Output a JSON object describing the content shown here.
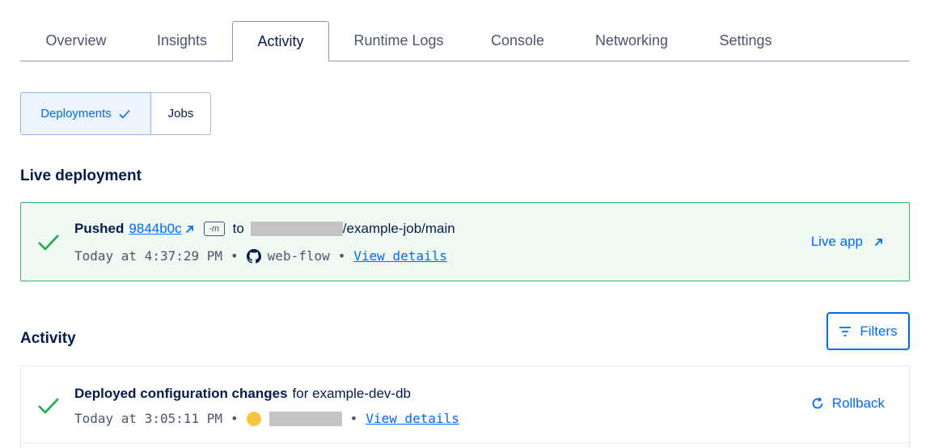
{
  "tabs": [
    {
      "label": "Overview"
    },
    {
      "label": "Insights"
    },
    {
      "label": "Activity"
    },
    {
      "label": "Runtime Logs"
    },
    {
      "label": "Console"
    },
    {
      "label": "Networking"
    },
    {
      "label": "Settings"
    }
  ],
  "active_tab": "Activity",
  "segmented": {
    "deployments_label": "Deployments",
    "jobs_label": "Jobs"
  },
  "live_deployment": {
    "section_title": "Live deployment",
    "action_word": "Pushed",
    "commit": "9844b0c",
    "flag": "-m",
    "to_word": "to",
    "repo_suffix": "/example-job/main",
    "timestamp": "Today at 4:37:29 PM",
    "separator": "•",
    "source": "web-flow",
    "details_link": "View details",
    "live_app_label": "Live app"
  },
  "activity": {
    "section_title": "Activity",
    "filters_label": "Filters",
    "items": [
      {
        "title": "Deployed configuration changes",
        "for_text": "for example-dev-db",
        "timestamp": "Today at 3:05:11 PM",
        "separator": "•",
        "details_link": "View details",
        "action_label": "Rollback"
      }
    ]
  },
  "colors": {
    "accent": "#0069ff",
    "success": "#1fa84f",
    "live_bg": "#f1f9f3",
    "live_border": "#3cb371",
    "text": "#031b4e"
  }
}
